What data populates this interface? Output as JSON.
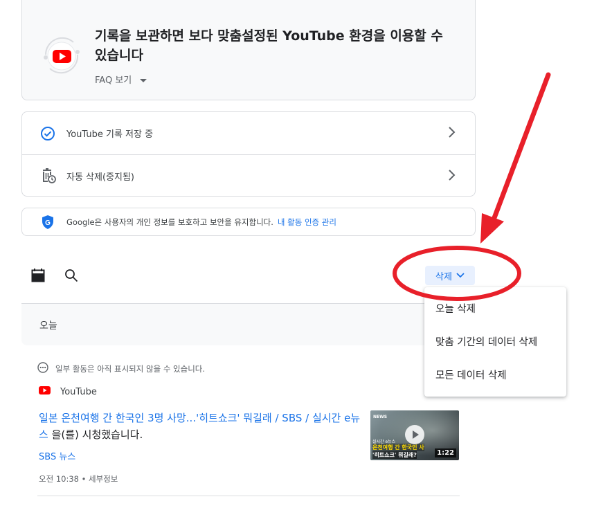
{
  "hero": {
    "title": "기록을 보관하면 보다 맞춤설정된 YouTube 환경을 이용할 수 있습니다",
    "faq_label": "FAQ 보기"
  },
  "settings": {
    "items": [
      {
        "label": "YouTube 기록 저장 중",
        "icon": "check-circle-icon"
      },
      {
        "label": "자동 삭제(중지됨)",
        "icon": "auto-delete-icon"
      }
    ]
  },
  "privacy_note": {
    "text": "Google은 사용자의 개인 정보를 보호하고 보안을 유지합니다.",
    "link": "내 활동 인증 관리"
  },
  "toolbar": {
    "delete_label": "삭제"
  },
  "delete_menu": {
    "items": [
      "오늘 삭제",
      "맞춤 기간의 데이터 삭제",
      "모든 데이터 삭제"
    ]
  },
  "activity": {
    "day_label": "오늘",
    "notice": "일부 활동은 아직 표시되지 않을 수 있습니다.",
    "source": "YouTube",
    "video_title": "일본 온천여행 간 한국인 3명 사망...'히트쇼크' 뭐길래 / SBS / 실시간 e뉴스",
    "watched_suffix": " 을(를) 시청했습니다.",
    "channel": "SBS 뉴스",
    "meta": "오전 10:38 • 세부정보",
    "thumbnail": {
      "corner_text": "NEWS",
      "small_caption": "실시간 e뉴스",
      "caption_line1": "온천여행 간 한국인 사",
      "caption_line2": "'히트쇼크' 뭐길래?",
      "duration": "1:22"
    }
  },
  "colors": {
    "accent": "#1a73e8",
    "annotation_red": "#e8202a",
    "youtube_red": "#ff0000"
  }
}
